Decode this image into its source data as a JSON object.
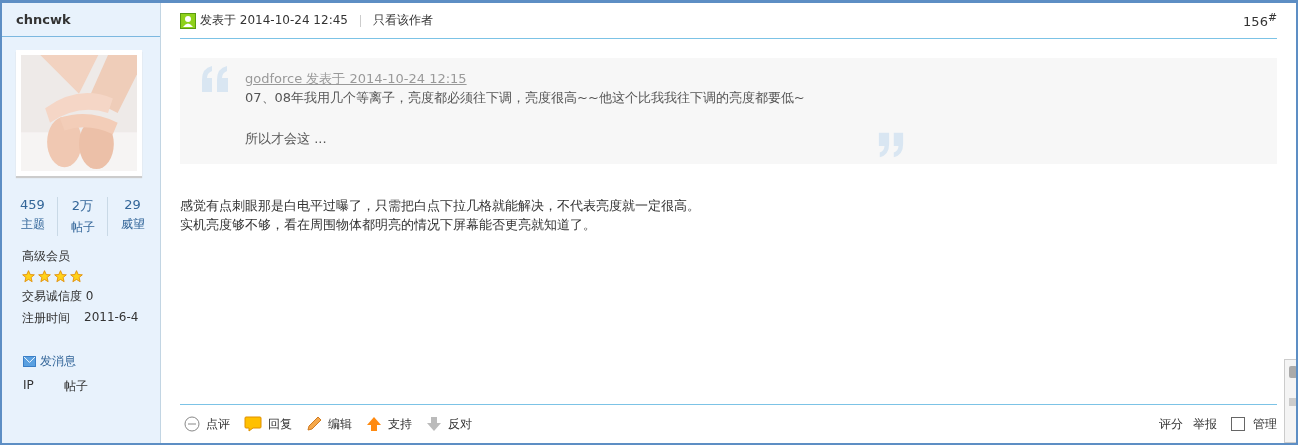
{
  "author": {
    "name": "chncwk",
    "stats": [
      {
        "value": "459",
        "label": "主题"
      },
      {
        "value": "2万",
        "label": "帖子"
      },
      {
        "value": "29",
        "label": "威望"
      }
    ],
    "group": "高级会员",
    "stars": 4,
    "credit": "交易诚信度 0",
    "reg_label": "注册时间",
    "reg_date": "2011-6-4",
    "message_link": "发消息",
    "ip_texts": [
      "IP",
      "帖子"
    ]
  },
  "post": {
    "posted": "发表于 2014-10-24 12:45",
    "only_author": "只看该作者",
    "floor": "156$^{#}$",
    "quote": {
      "source": "godforce 发表于 2014-10-24 12:15",
      "lines": [
        "07、08年我用几个等离子，亮度都必须往下调，亮度很高~~他这个比我我往下调的亮度都要低~",
        "所以才会这 ..."
      ]
    },
    "body": [
      "感觉有点刺眼那是白电平过曝了，只需把白点下拉几格就能解决，不代表亮度就一定很高。",
      "实机亮度够不够，看在周围物体都明亮的情况下屏幕能否更亮就知道了。"
    ],
    "actions": [
      {
        "kind": "comment",
        "label": "点评"
      },
      {
        "kind": "reply",
        "label": "回复"
      },
      {
        "kind": "edit",
        "label": "编辑"
      },
      {
        "kind": "up",
        "label": "支持"
      },
      {
        "kind": "down",
        "label": "反对"
      }
    ],
    "right_actions": [
      {
        "kind": "link",
        "label": "评分"
      },
      {
        "kind": "link",
        "label": "举报"
      },
      {
        "kind": "check",
        "label": "管理",
        "checked": false
      }
    ]
  }
}
